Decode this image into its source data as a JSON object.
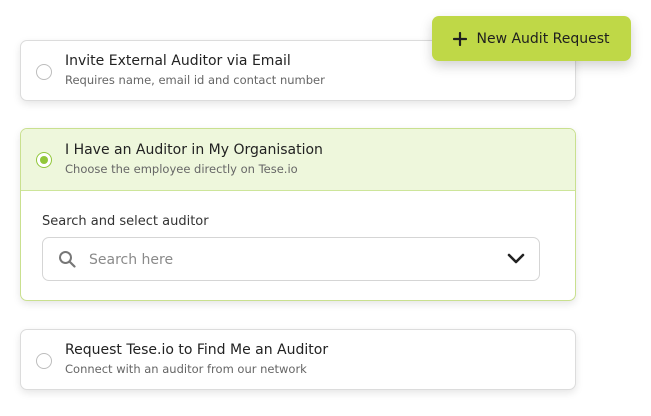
{
  "new_audit_button": {
    "label": "New Audit Request",
    "icon": "plus-icon"
  },
  "options": [
    {
      "title": "Invite External Auditor via Email",
      "subtitle": "Requires name, email id and contact number",
      "selected": false
    },
    {
      "title": "I Have an Auditor in My Organisation",
      "subtitle": "Choose the employee directly on Tese.io",
      "selected": true
    },
    {
      "title": "Request Tese.io to Find Me an Auditor",
      "subtitle": "Connect with an auditor from our network",
      "selected": false
    }
  ],
  "search": {
    "label": "Search and select auditor",
    "placeholder": "Search here",
    "value": ""
  },
  "colors": {
    "accent": "#92c73b",
    "button": "#bfd847",
    "selected_bg": "#eef7dc"
  }
}
